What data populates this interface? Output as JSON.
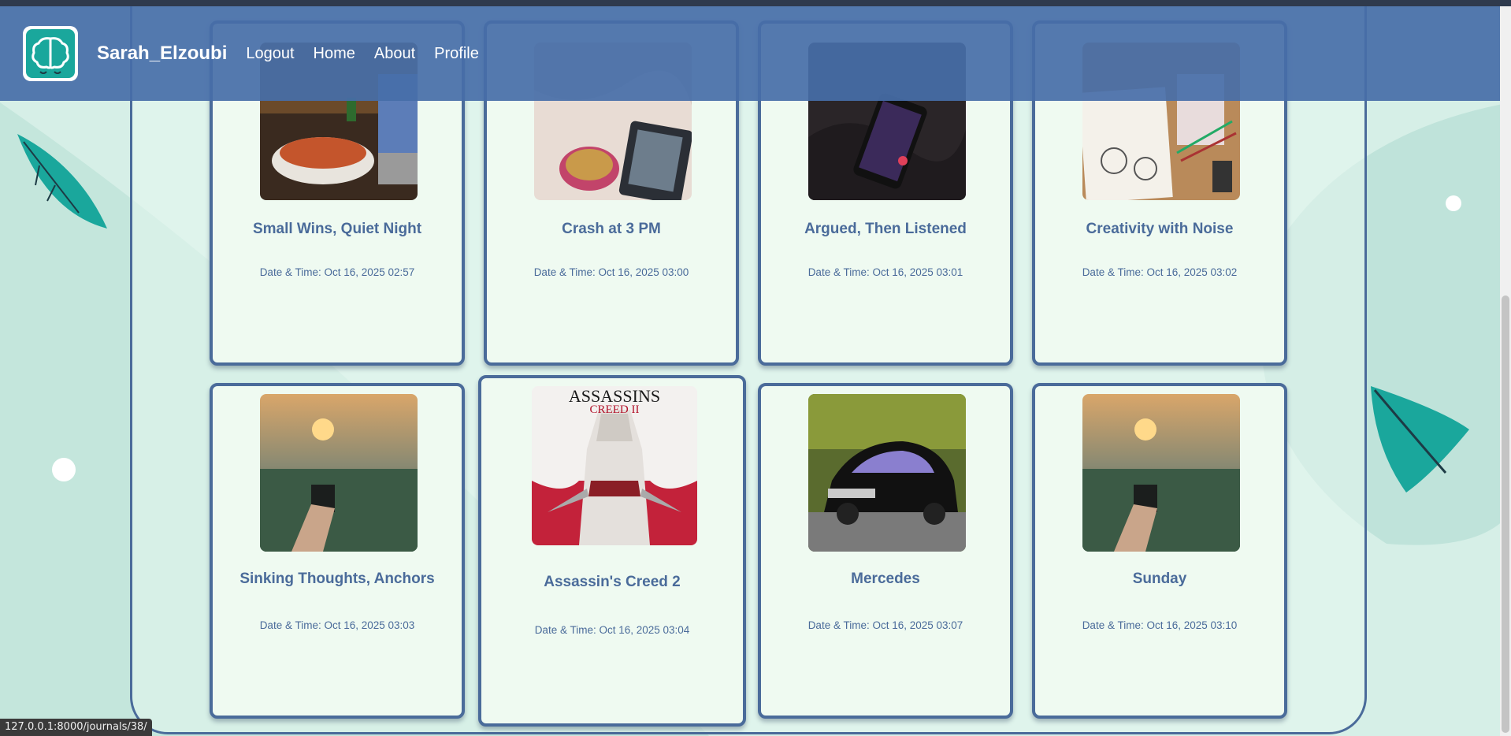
{
  "navbar": {
    "brand": "Sarah_Elzoubi",
    "links": [
      "Logout",
      "Home",
      "About",
      "Profile"
    ]
  },
  "journals": [
    {
      "title": "Small Wins, Quiet Night",
      "date": "Date & Time: Oct 16, 2025 02:57",
      "image": "ramen bowl beside laptop"
    },
    {
      "title": "Crash at 3 PM",
      "date": "Date & Time: Oct 16, 2025 03:00",
      "image": "tea cup and e-reader on bed"
    },
    {
      "title": "Argued, Then Listened",
      "date": "Date & Time: Oct 16, 2025 03:01",
      "image": "phone on dark fabric"
    },
    {
      "title": "Creativity with Noise",
      "date": "Date & Time: Oct 16, 2025 03:02",
      "image": "sketchbook and pens on desk"
    },
    {
      "title": "Sinking Thoughts, Anchors",
      "date": "Date & Time: Oct 16, 2025 03:03",
      "image": "misty sunrise with cup"
    },
    {
      "title": "Assassin's Creed 2",
      "date": "Date & Time: Oct 16, 2025 03:04",
      "image": "game cover art",
      "cover_text": [
        "ASSASSINS",
        "CREED II"
      ]
    },
    {
      "title": "Mercedes",
      "date": "Date & Time: Oct 16, 2025 03:07",
      "image": "black sedan on road"
    },
    {
      "title": "Sunday",
      "date": "Date & Time: Oct 16, 2025 03:10",
      "image": "misty sunrise with cup"
    }
  ],
  "status_url": "127.0.0.1:8000/journals/38/",
  "colors": {
    "navbar": "#466ea8",
    "card_border": "#4a6b9a",
    "card_bg": "#effaf1",
    "page_bg": "#d6efe7",
    "teal": "#1aa79c"
  },
  "icons": {
    "logo": "brain-icon"
  }
}
